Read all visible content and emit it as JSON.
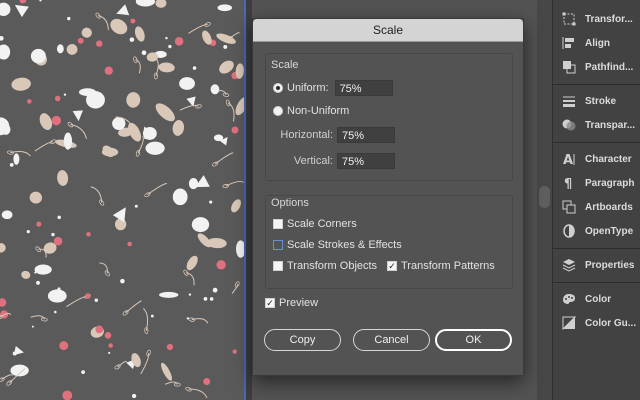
{
  "dialog": {
    "title": "Scale",
    "scale_section": "Scale",
    "uniform_label": "Uniform:",
    "uniform_value": "75%",
    "non_uniform_label": "Non-Uniform",
    "horizontal_label": "Horizontal:",
    "horizontal_value": "75%",
    "vertical_label": "Vertical:",
    "vertical_value": "75%",
    "options_section": "Options",
    "scale_corners_label": "Scale Corners",
    "scale_strokes_label": "Scale Strokes & Effects",
    "transform_objects_label": "Transform Objects",
    "transform_patterns_label": "Transform Patterns",
    "preview_label": "Preview",
    "copy_label": "Copy",
    "cancel_label": "Cancel",
    "ok_label": "OK",
    "selected_mode": "uniform",
    "checkboxes": {
      "scale_corners": false,
      "scale_strokes": false,
      "transform_objects": false,
      "transform_patterns": true,
      "preview": true
    }
  },
  "panels": [
    {
      "label": "Transfor...",
      "icon": "transform-icon"
    },
    {
      "label": "Align",
      "icon": "align-icon"
    },
    {
      "label": "Pathfind...",
      "icon": "pathfinder-icon"
    },
    {
      "label": "Stroke",
      "icon": "stroke-icon"
    },
    {
      "label": "Transpar...",
      "icon": "transparency-icon"
    },
    {
      "label": "Character",
      "icon": "character-icon"
    },
    {
      "label": "Paragraph",
      "icon": "paragraph-icon"
    },
    {
      "label": "Artboards",
      "icon": "artboards-icon"
    },
    {
      "label": "OpenType",
      "icon": "opentype-icon"
    },
    {
      "label": "Properties",
      "icon": "properties-icon"
    },
    {
      "label": "Color",
      "icon": "color-icon"
    },
    {
      "label": "Color Gu...",
      "icon": "color-guide-icon"
    }
  ],
  "colors": {
    "pattern_background": "#5a5a5a",
    "pattern_pink": "#e0707e",
    "pattern_beige": "#d9c7b8",
    "pattern_white": "#f2f2f2"
  }
}
